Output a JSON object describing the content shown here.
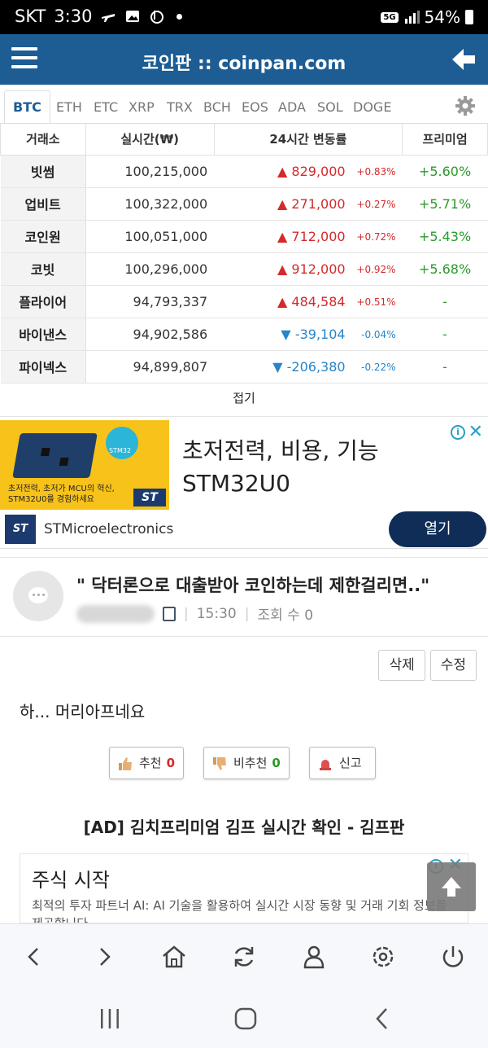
{
  "status_bar": {
    "carrier": "SKT",
    "time": "3:30",
    "network": "5G",
    "battery": "54%"
  },
  "header": {
    "title": "코인판 :: coinpan.com"
  },
  "coin_tabs": [
    "BTC",
    "ETH",
    "ETC",
    "XRP",
    "TRX",
    "BCH",
    "EOS",
    "ADA",
    "SOL",
    "DOGE"
  ],
  "active_tab": "BTC",
  "table": {
    "headers": [
      "거래소",
      "실시간(₩)",
      "24시간 변동률",
      "프리미엄"
    ],
    "rows": [
      {
        "exchange": "빗썸",
        "price": "100,215,000",
        "dir": "up",
        "arrow": "▲",
        "change": "829,000",
        "pct": "+0.83%",
        "premium": "+5.60%"
      },
      {
        "exchange": "업비트",
        "price": "100,322,000",
        "dir": "up",
        "arrow": "▲",
        "change": "271,000",
        "pct": "+0.27%",
        "premium": "+5.71%"
      },
      {
        "exchange": "코인원",
        "price": "100,051,000",
        "dir": "up",
        "arrow": "▲",
        "change": "712,000",
        "pct": "+0.72%",
        "premium": "+5.43%"
      },
      {
        "exchange": "코빗",
        "price": "100,296,000",
        "dir": "up",
        "arrow": "▲",
        "change": "912,000",
        "pct": "+0.92%",
        "premium": "+5.68%"
      },
      {
        "exchange": "플라이어",
        "price": "94,793,337",
        "dir": "up",
        "arrow": "▲",
        "change": "484,584",
        "pct": "+0.51%",
        "premium": "-"
      },
      {
        "exchange": "바이낸스",
        "price": "94,902,586",
        "dir": "down",
        "arrow": "▼",
        "change": "-39,104",
        "pct": "-0.04%",
        "premium": "-"
      },
      {
        "exchange": "파이넥스",
        "price": "94,899,807",
        "dir": "down",
        "arrow": "▼",
        "change": "-206,380",
        "pct": "-0.22%",
        "premium": "-"
      }
    ],
    "fold_label": "접기"
  },
  "ad1": {
    "headline_line1": "초저전력, 비용, 기능",
    "headline_line2": "STM32U0",
    "image_text_line1": "초저전력, 초저가 MCU의 혁신,",
    "image_text_line2": "STM32U0를 경험하세요",
    "chip_label": "STM32",
    "logo_text": "ST",
    "advertiser": "STMicroelectronics",
    "open_label": "열기",
    "info_icon": "i",
    "close_icon": "✕"
  },
  "post": {
    "title": "\" 닥터론으로 대출받아 코인하는데 제한걸리면..\"",
    "time": "15:30",
    "views_label": "조회 수 0",
    "delete_label": "삭제",
    "edit_label": "수정",
    "body": "하...  머리아프네요",
    "recommend_label": "추천",
    "recommend_count": "0",
    "not_recommend_label": "비추천",
    "not_recommend_count": "0",
    "report_label": "신고"
  },
  "ad_link_title": "[AD] 김치프리미엄 김프 실시간 확인 - 김프판",
  "ad2": {
    "title": "주식 시작",
    "desc": "최적의 투자 파트너 AI: AI 기술을 활용하여 실시간 시장 동향 및 거래 기회 정보를 제공합니다.",
    "info_icon": "i",
    "close_icon": "✕"
  },
  "colors": {
    "header": "#1d5d94",
    "up": "#d42a2a",
    "down": "#2784c8",
    "premium": "#2a9a2a",
    "open_button": "#0f2d56"
  }
}
